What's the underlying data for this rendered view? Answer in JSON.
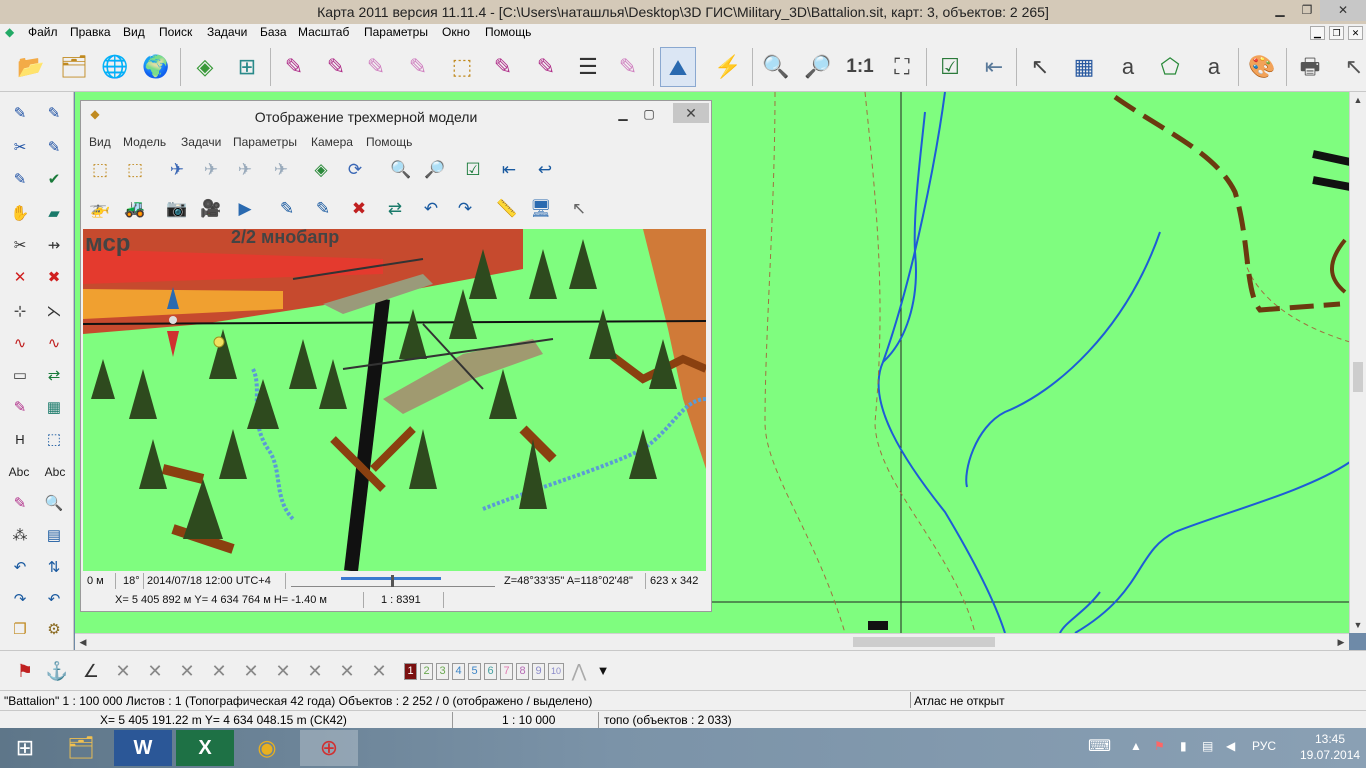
{
  "app": {
    "title": "Карта 2011 версия 11.11.4 - [C:\\Users\\наташлья\\Desktop\\3D ГИС\\Military_3D\\Battalion.sit, карт: 3, объектов: 2 265]"
  },
  "menu": [
    "Файл",
    "Правка",
    "Вид",
    "Поиск",
    "Задачи",
    "База",
    "Масштаб",
    "Параметры",
    "Окно",
    "Помощь"
  ],
  "toolbar": {
    "scale_1_1": "1:1"
  },
  "lefttoolbar": {
    "h_label": "H",
    "abc_1": "Abc",
    "abc_2": "Abc"
  },
  "window3d": {
    "title": "Отображение трехмерной модели",
    "menu": [
      "Вид",
      "Модель",
      "Задачи",
      "Параметры",
      "Камера",
      "Помощь"
    ],
    "scene_text": "мср",
    "scene_text2": "2/2 мнобапр",
    "status": {
      "height": "0 м",
      "angle": "18°",
      "datetime": "2014/07/18  12:00  UTC+4",
      "zenith_azimuth": "Z=48°33'35\"  A=118°02'48\"",
      "size": "623 x 342",
      "coords": "X= 5 405 892 м  Y= 4 634 764 м  H= -1.40 м",
      "scale": "1 : 8391"
    }
  },
  "bottomtoolbar": {
    "layers": [
      "1",
      "2",
      "3",
      "4",
      "5",
      "6",
      "7",
      "8",
      "9",
      "10"
    ],
    "layer_colors": [
      "#7a1010",
      "#6aa84f",
      "#6aa84f",
      "#3d85c6",
      "#3d85c6",
      "#45a1a1",
      "#e07ab0",
      "#b66bb6",
      "#8a8aca",
      "#8a8aca"
    ]
  },
  "status": {
    "doc_info": "\"Battalion\"  1 : 100 000   Листов : 1   (Топографическая 42 года)  Объектов : 2 252 / 0  (отображено / выделено)",
    "atlas": "Атлас не открыт",
    "coords": "X=  5 405 191.22 m      Y= 4 634 048.15 m  (СК42)",
    "scale": "1 : 10 000",
    "layer_info": "топо   (объектов : 2 033)"
  },
  "taskbar": {
    "lang": "РУС",
    "time": "13:45",
    "date": "19.07.2014"
  },
  "colors": {
    "map_bg": "#7ffd7f",
    "river": "#1e5cd6",
    "road": "#6b3a10",
    "trail": "#a07040"
  }
}
